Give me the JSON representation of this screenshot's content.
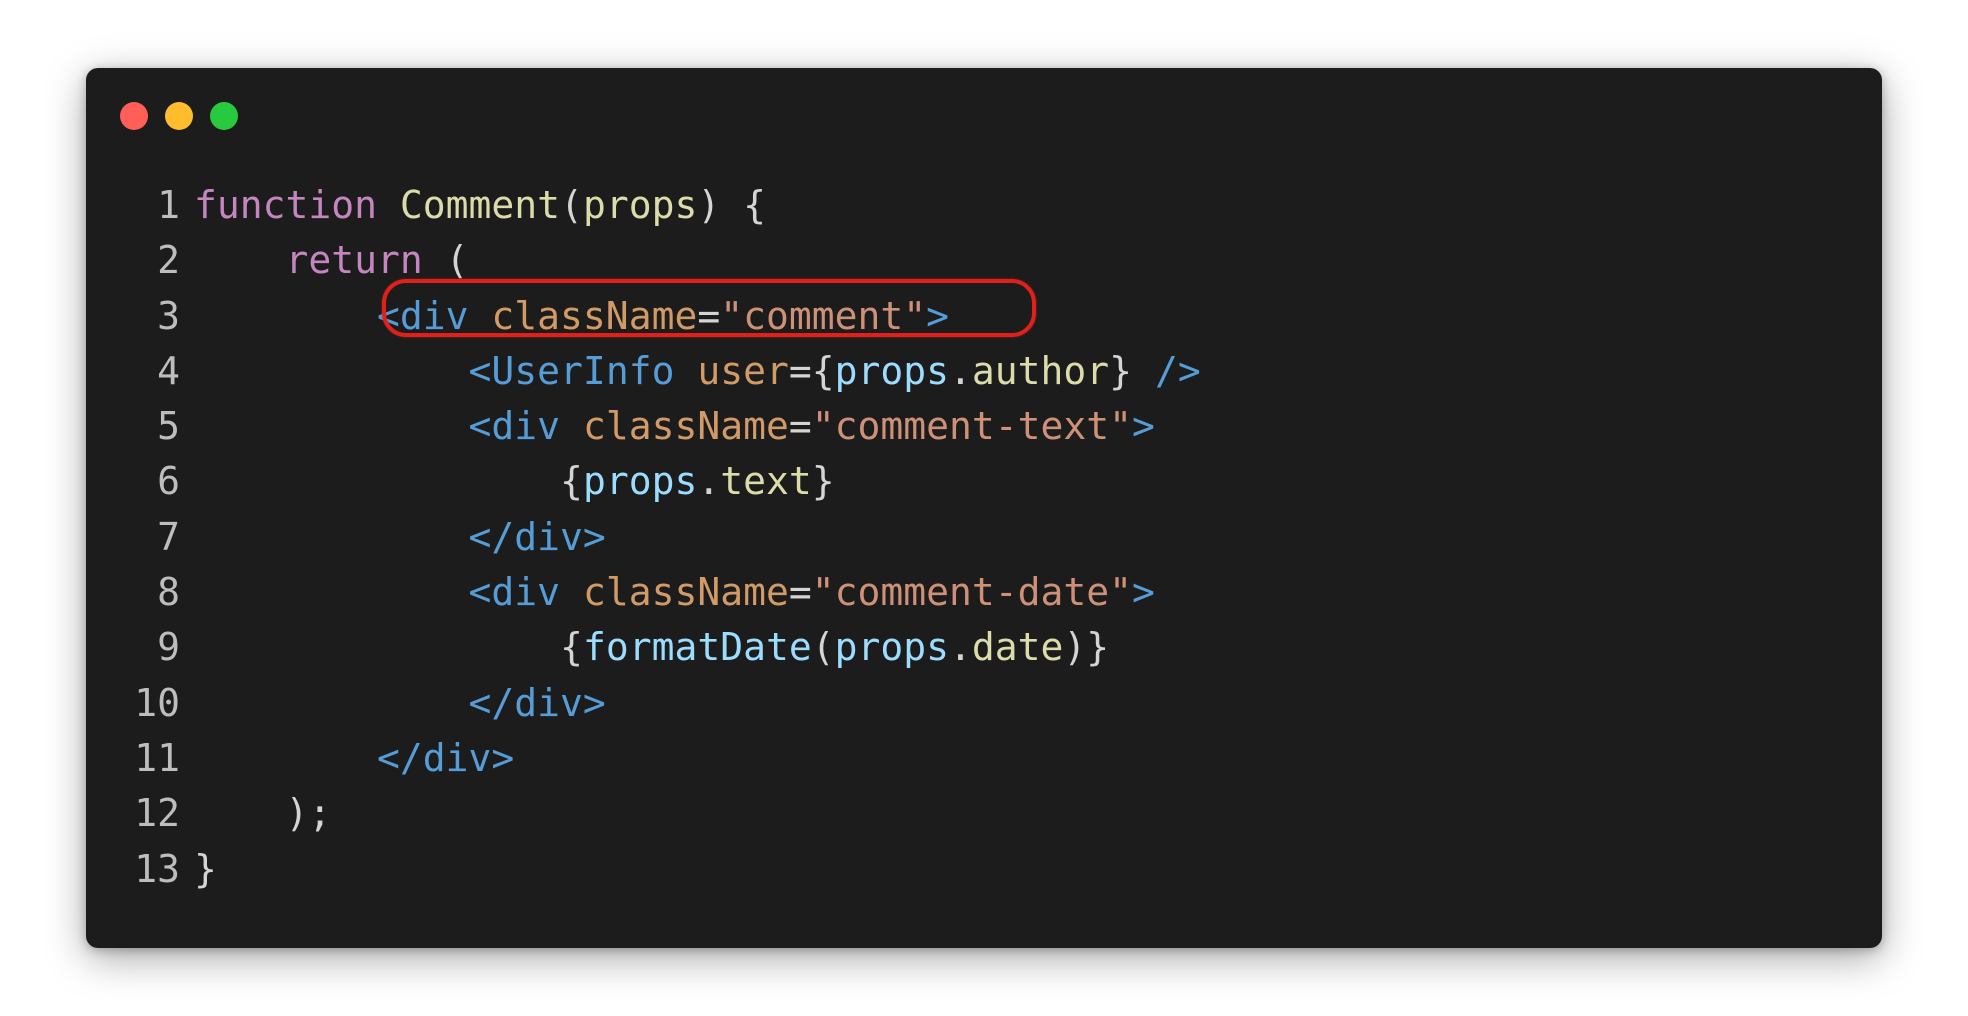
{
  "window": {
    "controls": [
      {
        "name": "close",
        "color": "#ff5f56"
      },
      {
        "name": "minimize",
        "color": "#ffbd2e"
      },
      {
        "name": "maximize",
        "color": "#27c93f"
      }
    ]
  },
  "colors": {
    "keyword": "#c586c0",
    "function": "#dcdcaa",
    "identifier": "#9cdcfe",
    "punctuation": "#d4d4d4",
    "tag": "#569cd6",
    "attribute": "#d19a66",
    "string": "#ce9178",
    "line_number": "#bdbdbd",
    "highlight": "#e0201a"
  },
  "code": {
    "lines": [
      {
        "number": "1",
        "tokens": [
          {
            "text": "function ",
            "type": "keyword"
          },
          {
            "text": "Comment",
            "type": "function"
          },
          {
            "text": "(",
            "type": "punctuation"
          },
          {
            "text": "props",
            "type": "function"
          },
          {
            "text": ") {",
            "type": "punctuation"
          }
        ]
      },
      {
        "number": "2",
        "tokens": [
          {
            "text": "    ",
            "type": "punctuation"
          },
          {
            "text": "return",
            "type": "keyword"
          },
          {
            "text": " (",
            "type": "punctuation"
          }
        ]
      },
      {
        "number": "3",
        "tokens": [
          {
            "text": "        ",
            "type": "punctuation"
          },
          {
            "text": "<div ",
            "type": "tag"
          },
          {
            "text": "className",
            "type": "attribute"
          },
          {
            "text": "=",
            "type": "punctuation"
          },
          {
            "text": "\"comment\"",
            "type": "string"
          },
          {
            "text": ">",
            "type": "tag"
          }
        ]
      },
      {
        "number": "4",
        "highlighted": true,
        "tokens": [
          {
            "text": "            ",
            "type": "punctuation"
          },
          {
            "text": "<UserInfo ",
            "type": "tag"
          },
          {
            "text": "user",
            "type": "attribute"
          },
          {
            "text": "={",
            "type": "punctuation"
          },
          {
            "text": "props",
            "type": "identifier"
          },
          {
            "text": ".",
            "type": "punctuation"
          },
          {
            "text": "author",
            "type": "function"
          },
          {
            "text": "} ",
            "type": "punctuation"
          },
          {
            "text": "/>",
            "type": "tag"
          }
        ]
      },
      {
        "number": "5",
        "tokens": [
          {
            "text": "            ",
            "type": "punctuation"
          },
          {
            "text": "<div ",
            "type": "tag"
          },
          {
            "text": "className",
            "type": "attribute"
          },
          {
            "text": "=",
            "type": "punctuation"
          },
          {
            "text": "\"comment-text\"",
            "type": "string"
          },
          {
            "text": ">",
            "type": "tag"
          }
        ]
      },
      {
        "number": "6",
        "tokens": [
          {
            "text": "                {",
            "type": "punctuation"
          },
          {
            "text": "props",
            "type": "identifier"
          },
          {
            "text": ".",
            "type": "punctuation"
          },
          {
            "text": "text",
            "type": "function"
          },
          {
            "text": "}",
            "type": "punctuation"
          }
        ]
      },
      {
        "number": "7",
        "tokens": [
          {
            "text": "            ",
            "type": "punctuation"
          },
          {
            "text": "</div>",
            "type": "tag"
          }
        ]
      },
      {
        "number": "8",
        "tokens": [
          {
            "text": "            ",
            "type": "punctuation"
          },
          {
            "text": "<div ",
            "type": "tag"
          },
          {
            "text": "className",
            "type": "attribute"
          },
          {
            "text": "=",
            "type": "punctuation"
          },
          {
            "text": "\"comment-date\"",
            "type": "string"
          },
          {
            "text": ">",
            "type": "tag"
          }
        ]
      },
      {
        "number": "9",
        "tokens": [
          {
            "text": "                {",
            "type": "punctuation"
          },
          {
            "text": "formatDate",
            "type": "identifier"
          },
          {
            "text": "(",
            "type": "punctuation"
          },
          {
            "text": "props",
            "type": "identifier"
          },
          {
            "text": ".",
            "type": "punctuation"
          },
          {
            "text": "date",
            "type": "function"
          },
          {
            "text": ")}",
            "type": "punctuation"
          }
        ]
      },
      {
        "number": "10",
        "tokens": [
          {
            "text": "            ",
            "type": "punctuation"
          },
          {
            "text": "</div>",
            "type": "tag"
          }
        ]
      },
      {
        "number": "11",
        "tokens": [
          {
            "text": "        ",
            "type": "punctuation"
          },
          {
            "text": "</div>",
            "type": "tag"
          }
        ]
      },
      {
        "number": "12",
        "tokens": [
          {
            "text": "    );",
            "type": "punctuation"
          }
        ]
      },
      {
        "number": "13",
        "tokens": [
          {
            "text": "}",
            "type": "punctuation"
          }
        ]
      }
    ]
  }
}
